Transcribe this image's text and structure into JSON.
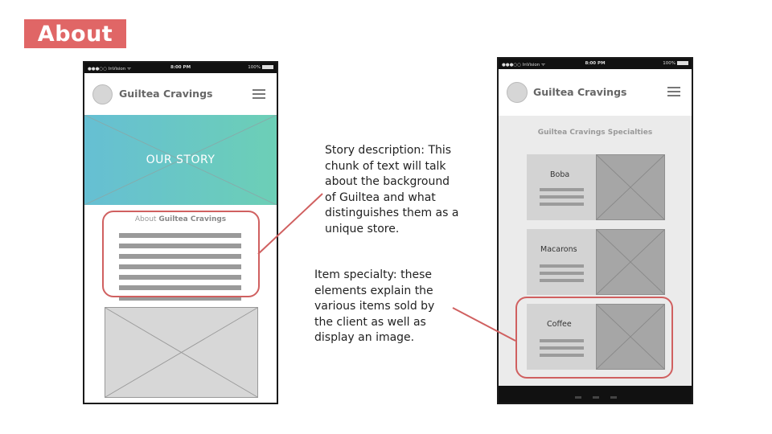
{
  "slide": {
    "title": "About"
  },
  "left_phone": {
    "status": {
      "carrier": "●●●○○ InVision ᯤ",
      "time": "8:00 PM",
      "battery": "100%"
    },
    "brand": "Guiltea Cravings",
    "hero_text": "OUR STORY",
    "about_prefix": "About",
    "about_brand": "Guiltea Cravings",
    "text_line_count": 7
  },
  "right_phone": {
    "status": {
      "carrier": "●●●○○ InVision ᯤ",
      "time": "8:00 PM",
      "battery": "100%"
    },
    "brand": "Guiltea Cravings",
    "section_title": "Guiltea Cravings Specialties",
    "items": [
      {
        "label": "Boba"
      },
      {
        "label": "Macarons"
      },
      {
        "label": "Coffee"
      }
    ]
  },
  "annotations": {
    "story_lines": [
      "Story description: This",
      "chunk of text will talk",
      "about the background",
      "of Guiltea and what",
      "distinguishes them as a",
      "unique store."
    ],
    "item_lines": [
      "Item specialty: these",
      "elements explain the",
      "various items sold by",
      "the client as well as",
      "display an image."
    ]
  },
  "colors": {
    "accent": "#e06666",
    "callout": "#d06060",
    "hero_start": "#66bfd3",
    "hero_end": "#6ccfb6"
  },
  "icons": {
    "menu": "hamburger-menu-icon",
    "logo": "logo-placeholder-icon",
    "image": "image-placeholder-icon"
  }
}
